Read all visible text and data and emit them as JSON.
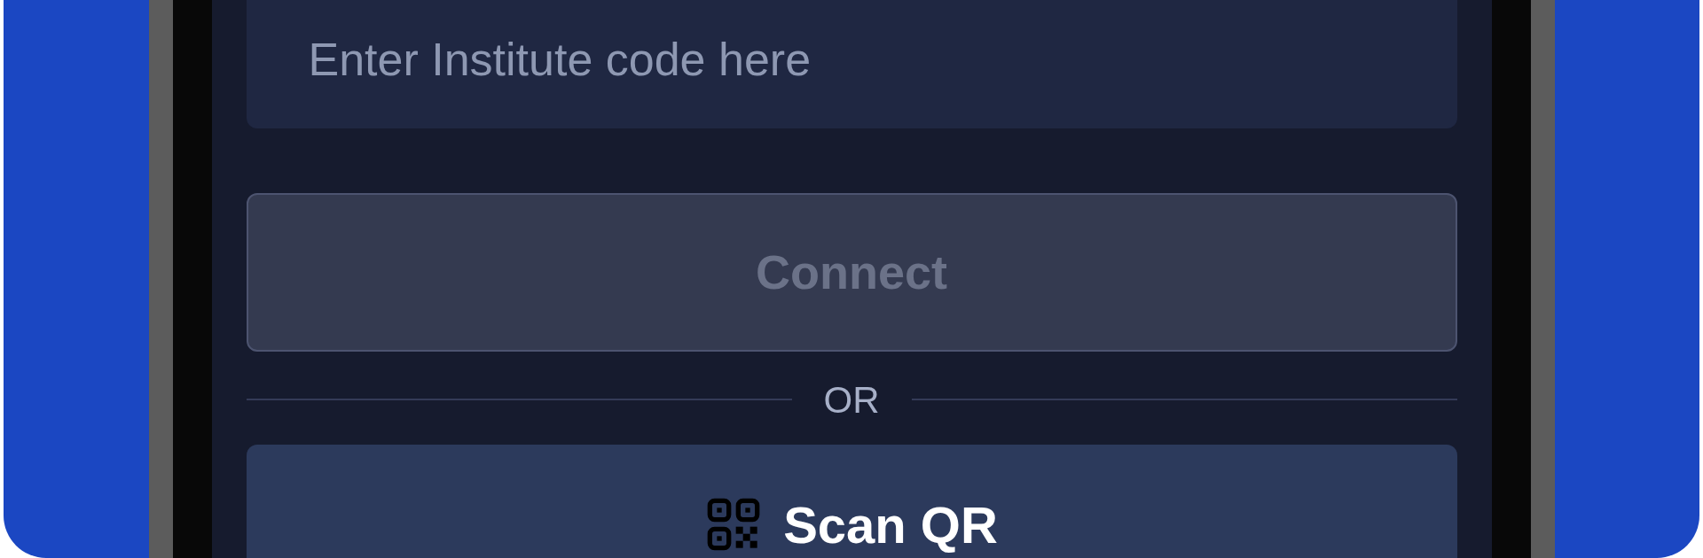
{
  "institute_code_field": {
    "placeholder": "Enter Institute code here"
  },
  "connect_button": {
    "label": "Connect",
    "disabled": true
  },
  "divider": {
    "label": "OR"
  },
  "scan_qr_button": {
    "label": "Scan QR"
  }
}
